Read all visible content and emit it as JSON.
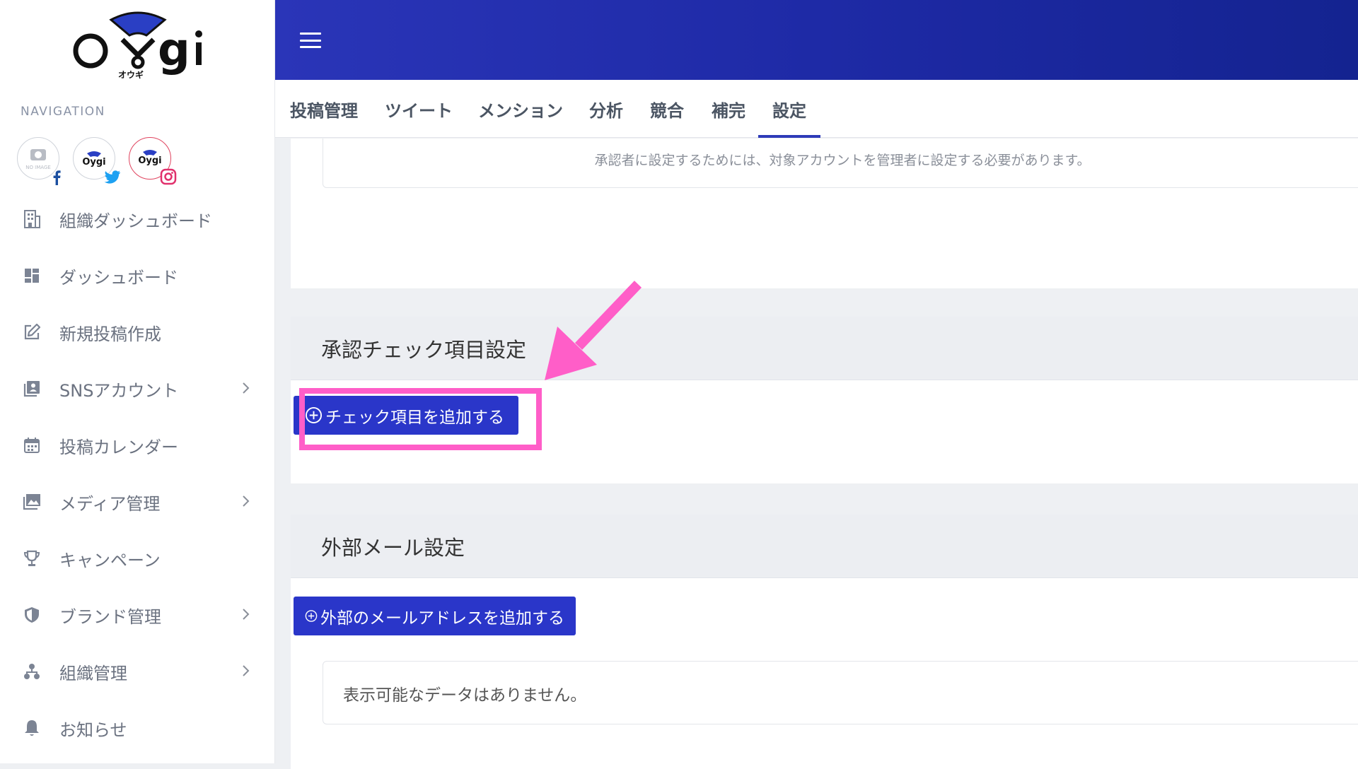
{
  "brand": {
    "logo_text": "O gi",
    "logo_kana": "オウギ"
  },
  "sidebar": {
    "heading": "NAVIGATION",
    "accounts": [
      {
        "name": "facebook-account",
        "image": "NO IMAGE",
        "network": "facebook"
      },
      {
        "name": "twitter-account",
        "image": "Oygi",
        "network": "twitter"
      },
      {
        "name": "instagram-account",
        "image": "Oygi",
        "network": "instagram"
      }
    ],
    "items": [
      {
        "label": "組織ダッシュボード",
        "icon": "building-icon",
        "has_children": false
      },
      {
        "label": "ダッシュボード",
        "icon": "dashboard-icon",
        "has_children": false
      },
      {
        "label": "新規投稿作成",
        "icon": "edit-icon",
        "has_children": false
      },
      {
        "label": "SNSアカウント",
        "icon": "account-card-icon",
        "has_children": true
      },
      {
        "label": "投稿カレンダー",
        "icon": "calendar-icon",
        "has_children": false
      },
      {
        "label": "メディア管理",
        "icon": "image-icon",
        "has_children": true
      },
      {
        "label": "キャンペーン",
        "icon": "trophy-icon",
        "has_children": false
      },
      {
        "label": "ブランド管理",
        "icon": "shield-icon",
        "has_children": true
      },
      {
        "label": "組織管理",
        "icon": "org-chart-icon",
        "has_children": true
      },
      {
        "label": "お知らせ",
        "icon": "bell-icon",
        "has_children": false
      }
    ]
  },
  "tabs": [
    {
      "label": "投稿管理",
      "active": false
    },
    {
      "label": "ツイート",
      "active": false
    },
    {
      "label": "メンション",
      "active": false
    },
    {
      "label": "分析",
      "active": false
    },
    {
      "label": "競合",
      "active": false
    },
    {
      "label": "補完",
      "active": false
    },
    {
      "label": "設定",
      "active": true
    }
  ],
  "approver_note": "承認者に設定するためには、対象アカウントを管理者に設定する必要があります。",
  "approval_check": {
    "title": "承認チェック項目設定",
    "add_button": "チェック項目を追加する"
  },
  "external_mail": {
    "title": "外部メール設定",
    "add_button": "外部のメールアドレスを追加する",
    "empty_text": "表示可能なデータはありません。"
  },
  "colors": {
    "topbar": "#1e2aa6",
    "primary_button": "#2a36c9",
    "highlight": "#ff5ec8",
    "tab_indicator": "#2e3bb8"
  }
}
